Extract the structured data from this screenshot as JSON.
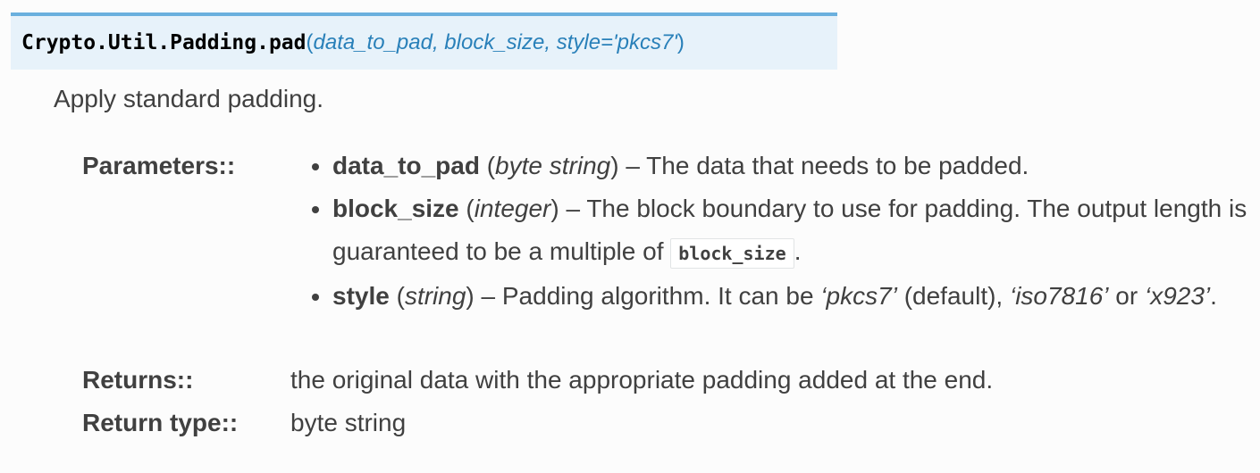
{
  "signature": {
    "name": "Crypto.Util.Padding.pad",
    "open_paren": "(",
    "params": "data_to_pad, block_size, style='pkcs7'",
    "close_paren": ")"
  },
  "summary": "Apply standard padding.",
  "fields": {
    "parameters_label": "Parameters::",
    "returns_label": "Returns::",
    "returns_text": "the original data with the appropriate padding added at the end.",
    "return_type_label": "Return type::",
    "return_type_text": "byte string"
  },
  "parameters": [
    {
      "name": "data_to_pad",
      "type": "byte string",
      "desc": "The data that needs to be padded."
    },
    {
      "name": "block_size",
      "type": "integer",
      "desc": "The block boundary to use for padding. The output length is guaranteed to be a multiple of",
      "code": "block_size",
      "after": "."
    },
    {
      "name": "style",
      "type": "string",
      "desc_parts": [
        "Padding algorithm. It can be ",
        "‘pkcs7’",
        " (default), ",
        "‘iso7816’",
        " or ",
        "‘x923’",
        "."
      ]
    }
  ],
  "colors": {
    "sig_background": "#e7f2fa",
    "sig_border": "#6ab0de",
    "sig_params": "#2980b9",
    "text": "#404040"
  }
}
